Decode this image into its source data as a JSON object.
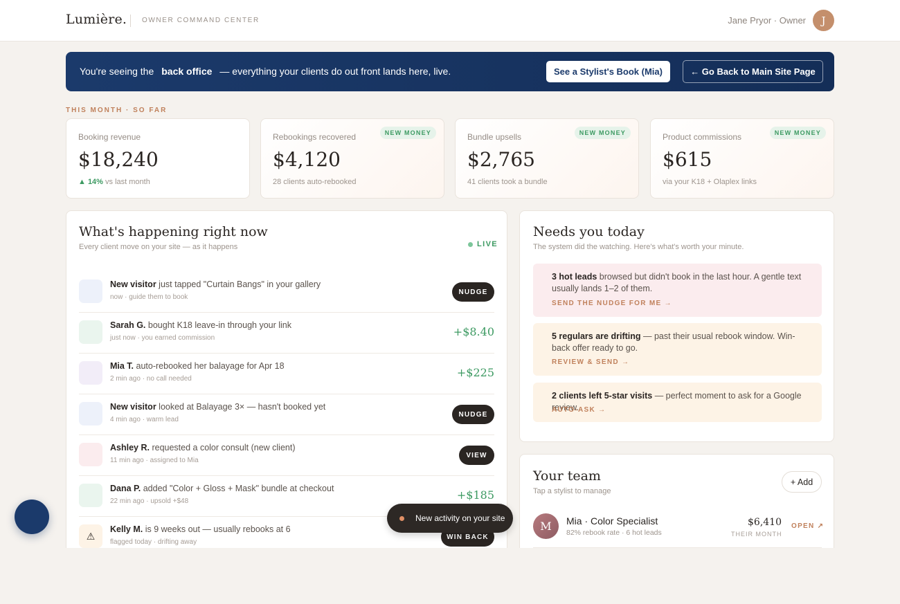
{
  "header": {
    "brand": "Lumière.",
    "subtitle": "OWNER COMMAND CENTER",
    "user": "Jane Pryor · Owner",
    "avatar_initial": "J"
  },
  "banner": {
    "icon": "",
    "text_before": "You're seeing the",
    "text_bold": "back office",
    "text_after": "— everything your clients do out front lands here, live.",
    "stylist_button": "See a Stylist's Book (Mia)",
    "back_button": "← Go Back to Main Site Page"
  },
  "section_label": "THIS MONTH · SO FAR",
  "stats": [
    {
      "label": "Booking revenue",
      "value": "$18,240",
      "sub_up": "▲ 14%",
      "sub": "vs last month",
      "badge": ""
    },
    {
      "label": "Rebookings recovered",
      "value": "$4,120",
      "sub_up": "",
      "sub": "28 clients auto-rebooked",
      "badge": "NEW MONEY"
    },
    {
      "label": "Bundle upsells",
      "value": "$2,765",
      "sub_up": "",
      "sub": "41 clients took a bundle",
      "badge": "NEW MONEY"
    },
    {
      "label": "Product commissions",
      "value": "$615",
      "sub_up": "",
      "sub": "via your K18 + Olaplex links",
      "badge": "NEW MONEY"
    }
  ],
  "feed": {
    "title": "What's happening right now",
    "subtitle": "Every client move on your site — as it happens",
    "live_label": "LIVE",
    "rows": [
      {
        "icon": "",
        "actor": "New visitor",
        "text": "just tapped \"Curtain Bangs\" in your gallery",
        "meta": "now · guide them to book",
        "action": "NUDGE",
        "amount": ""
      },
      {
        "icon": "",
        "actor": "Sarah G.",
        "text": "bought K18 leave-in through your link",
        "meta": "just now · you earned commission",
        "action": "",
        "amount": "+$8.40"
      },
      {
        "icon": "",
        "actor": "Mia T.",
        "text": "auto-rebooked her balayage for Apr 18",
        "meta": "2 min ago · no call needed",
        "action": "",
        "amount": "+$225"
      },
      {
        "icon": "",
        "actor": "New visitor",
        "text": "looked at Balayage 3× — hasn't booked yet",
        "meta": "4 min ago · warm lead",
        "action": "NUDGE",
        "amount": ""
      },
      {
        "icon": "",
        "actor": "Ashley R.",
        "text": "requested a color consult (new client)",
        "meta": "11 min ago · assigned to Mia",
        "action": "VIEW",
        "amount": ""
      },
      {
        "icon": "",
        "actor": "Dana P.",
        "text": "added \"Color + Gloss + Mask\" bundle at checkout",
        "meta": "22 min ago · upsold +$48",
        "action": "",
        "amount": "+$185"
      },
      {
        "icon": "⚠",
        "actor": "Kelly M.",
        "text": "is 9 weeks out — usually rebooks at 6",
        "meta": "flagged today · drifting away",
        "action": "WIN BACK",
        "amount": ""
      }
    ]
  },
  "needs": {
    "title": "Needs you today",
    "subtitle": "The system did the watching. Here's what's worth your minute.",
    "cards": [
      {
        "icon": "",
        "bold": "3 hot leads",
        "text": "browsed but didn't book in the last hour. A gentle text usually lands 1–2 of them.",
        "link": "SEND THE NUDGE FOR ME →"
      },
      {
        "icon": "",
        "bold": "5 regulars are drifting",
        "text": "— past their usual rebook window. Win-back offer ready to go.",
        "link": "REVIEW & SEND →"
      },
      {
        "icon": "",
        "bold": "2 clients left 5-star visits",
        "text": "— perfect moment to ask for a Google review.",
        "link": "AUTO-ASK →"
      }
    ]
  },
  "team": {
    "title": "Your team",
    "subtitle": "Tap a stylist to manage",
    "add_button": "+ Add",
    "members": [
      {
        "initial": "M",
        "name": "Mia · Color Specialist",
        "meta": "82% rebook rate · 6 hot leads",
        "amount": "$6,410",
        "amount_label": "THEIR MONTH",
        "open": "OPEN ↗"
      }
    ]
  },
  "fab_icon": "",
  "toast": {
    "icon": "",
    "text": "New activity on your site"
  },
  "colors": {
    "navy": "#1b3a6b",
    "accent": "#c0815c",
    "green": "#3d9a62",
    "dark": "#2a2522"
  }
}
